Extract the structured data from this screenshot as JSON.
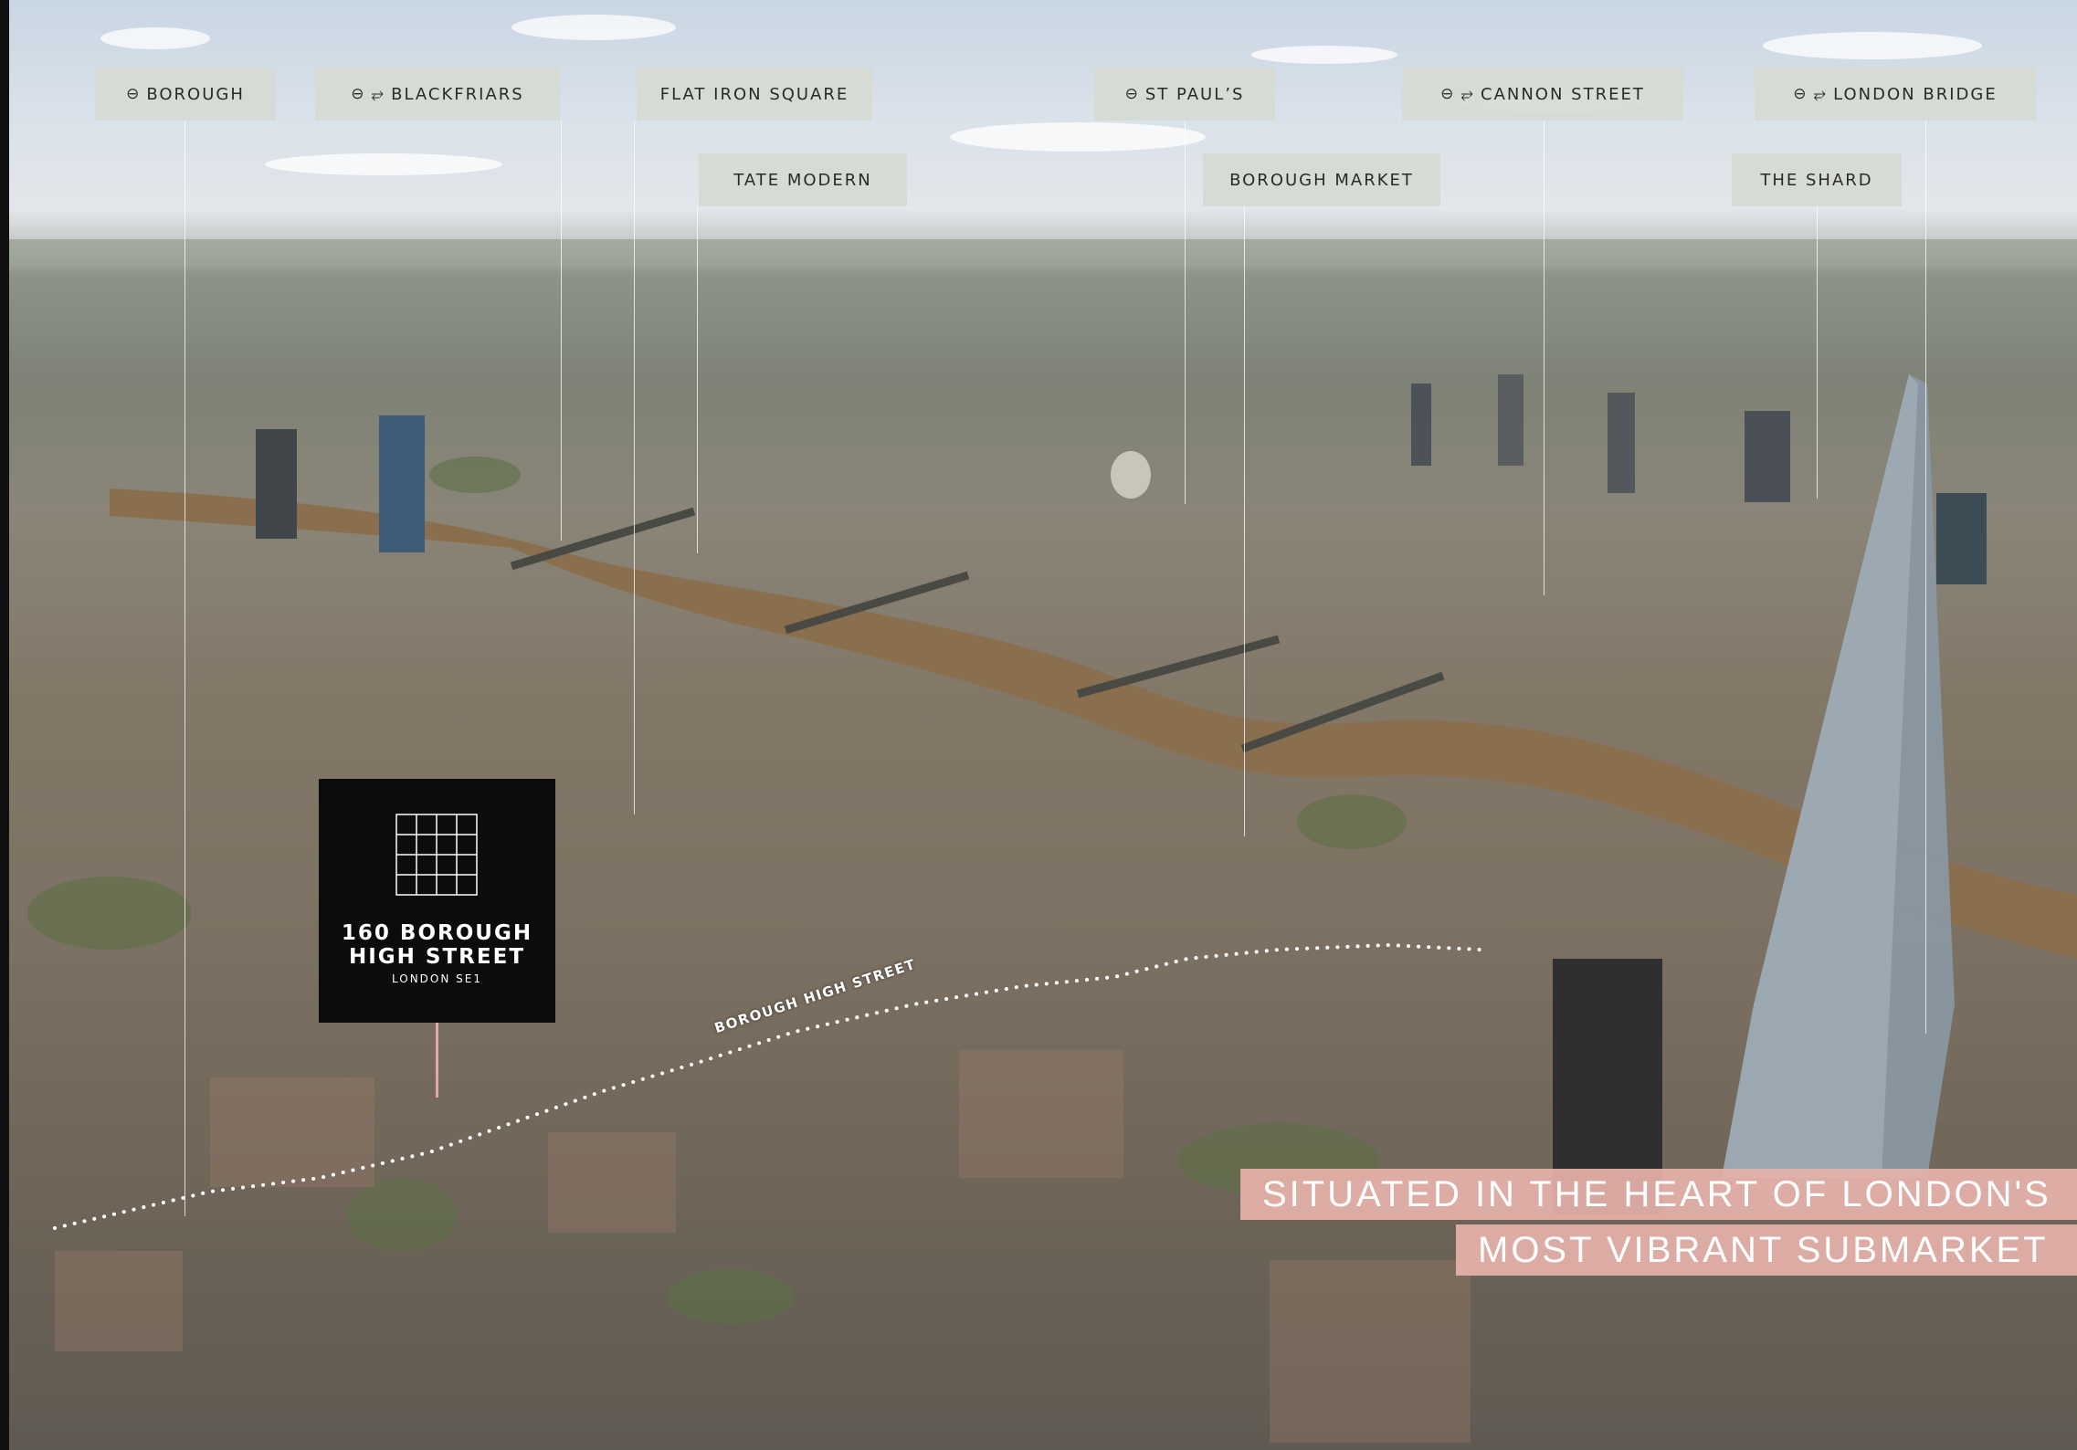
{
  "labels": [
    {
      "id": "borough",
      "text": "BOROUGH",
      "icons": [
        "underground-roundel"
      ]
    },
    {
      "id": "blackfriars",
      "text": "BLACKFRIARS",
      "icons": [
        "underground-roundel",
        "national-rail"
      ]
    },
    {
      "id": "flat-iron-square",
      "text": "FLAT IRON SQUARE",
      "icons": []
    },
    {
      "id": "st-pauls",
      "text": "ST PAUL’S",
      "icons": [
        "underground-roundel"
      ]
    },
    {
      "id": "cannon-street",
      "text": "CANNON STREET",
      "icons": [
        "underground-roundel",
        "national-rail"
      ]
    },
    {
      "id": "london-bridge",
      "text": "LONDON BRIDGE",
      "icons": [
        "underground-roundel",
        "national-rail"
      ]
    },
    {
      "id": "tate-modern",
      "text": "TATE MODERN",
      "icons": []
    },
    {
      "id": "borough-market",
      "text": "BOROUGH MARKET",
      "icons": []
    },
    {
      "id": "the-shard",
      "text": "THE SHARD",
      "icons": []
    }
  ],
  "icons": {
    "underground": "⊖",
    "rail": "⥂"
  },
  "property": {
    "line1": "160 BOROUGH",
    "line2": "HIGH STREET",
    "line3": "LONDON SE1",
    "icon": "grid-logo"
  },
  "street": {
    "name": "BOROUGH HIGH STREET"
  },
  "tagline": {
    "line1": "SITUATED IN THE HEART OF LONDON'S",
    "line2": "MOST VIBRANT SUBMARKET"
  },
  "colors": {
    "label_bg": "#d6dad4",
    "property_bg": "#0c0c0c",
    "tagline_bg": "#e6b2aa",
    "river": "#8a6f4f"
  }
}
